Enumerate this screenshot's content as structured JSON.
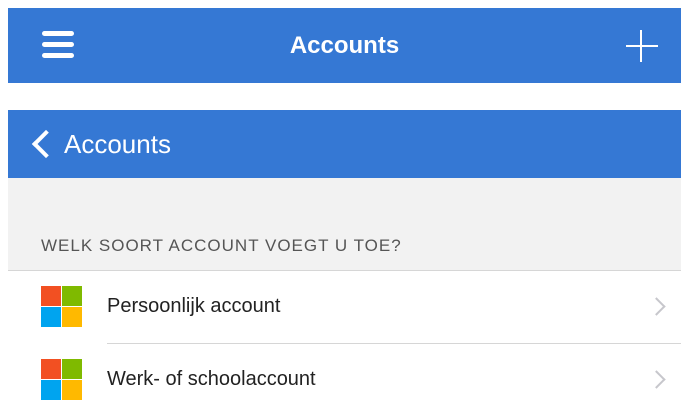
{
  "topbar": {
    "title": "Accounts",
    "menu_icon": "hamburger-icon",
    "add_icon": "plus-icon",
    "color": "#3578d4"
  },
  "subbar": {
    "back_label": "Accounts",
    "back_icon": "chevron-left-icon"
  },
  "section": {
    "header": "WELK SOORT ACCOUNT VOEGT U TOE?"
  },
  "options": [
    {
      "label": "Persoonlijk account",
      "icon": "microsoft-logo-icon"
    },
    {
      "label": "Werk- of schoolaccount",
      "icon": "microsoft-logo-icon"
    }
  ],
  "logo_colors": [
    "#f25022",
    "#7fba00",
    "#00a4ef",
    "#ffb900"
  ]
}
